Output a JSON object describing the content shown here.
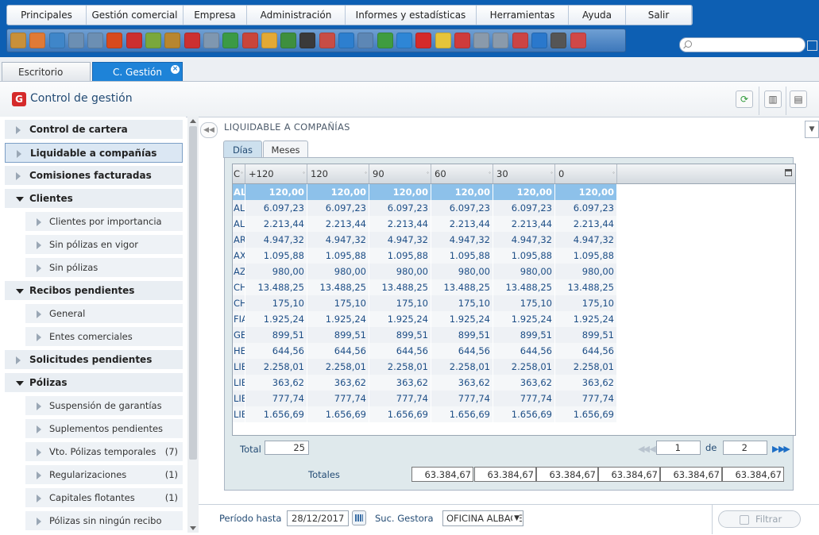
{
  "menu": [
    "Principales",
    "Gestión comercial",
    "Empresa",
    "Administración",
    "Informes y estadísticas",
    "Herramientas",
    "Ayuda",
    "Salir"
  ],
  "toolbar_icons": [
    {
      "name": "box-icon",
      "color": "#c8903a"
    },
    {
      "name": "user-orange-icon",
      "color": "#e07a36"
    },
    {
      "name": "user-blue-icon",
      "color": "#3f86c9"
    },
    {
      "name": "window-icon",
      "color": "#6c8fb3"
    },
    {
      "name": "window-split-icon",
      "color": "#6c8fb3"
    },
    {
      "name": "fire-icon",
      "color": "#d84a1d"
    },
    {
      "name": "target-icon",
      "color": "#cc2f2f"
    },
    {
      "name": "money-icon",
      "color": "#7aa83c"
    },
    {
      "name": "briefcase-icon",
      "color": "#b8862f"
    },
    {
      "name": "alarm-icon",
      "color": "#cc3030"
    },
    {
      "name": "mail-icon",
      "color": "#7f97b0"
    },
    {
      "name": "building-icon",
      "color": "#3b9a45"
    },
    {
      "name": "person-red-icon",
      "color": "#c9453a"
    },
    {
      "name": "lightbulb-person-icon",
      "color": "#e3a935"
    },
    {
      "name": "flag-icon",
      "color": "#3e8f3e"
    },
    {
      "name": "euro-dark-icon",
      "color": "#3a3a3a"
    },
    {
      "name": "person-euro-icon",
      "color": "#c84d45"
    },
    {
      "name": "euro-blue-icon",
      "color": "#2d7fcf"
    },
    {
      "name": "euro-arrow-icon",
      "color": "#5d87b5"
    },
    {
      "name": "euro-green-icon",
      "color": "#3f9c3f"
    },
    {
      "name": "sync-icon",
      "color": "#2e86d6"
    },
    {
      "name": "g-logo-icon",
      "color": "#d52a2a"
    },
    {
      "name": "bulb-icon",
      "color": "#e6c43a"
    },
    {
      "name": "card-icon",
      "color": "#cf3b3b"
    },
    {
      "name": "document-icon",
      "color": "#8a9aab"
    },
    {
      "name": "printer-doc-icon",
      "color": "#8a9aab"
    },
    {
      "name": "report-icon",
      "color": "#cc4444"
    },
    {
      "name": "pen-icon",
      "color": "#2a78cc"
    },
    {
      "name": "tools-icon",
      "color": "#555555"
    },
    {
      "name": "help-icon",
      "color": "#d04848"
    }
  ],
  "search": {
    "placeholder": ""
  },
  "tabs": [
    "Escritorio",
    "C. Gestión"
  ],
  "page_title": "Control de gestión",
  "app_logo": "G",
  "sidebar": [
    {
      "label": "Control de cartera",
      "level": 0,
      "state": "closed",
      "count": ""
    },
    {
      "label": "Liquidable a compañías",
      "level": 0,
      "state": "closed",
      "count": "",
      "selected": true
    },
    {
      "label": "Comisiones facturadas",
      "level": 0,
      "state": "closed",
      "count": ""
    },
    {
      "label": "Clientes",
      "level": 0,
      "state": "open",
      "count": ""
    },
    {
      "label": "Clientes por importancia",
      "level": 1,
      "state": "closed",
      "count": ""
    },
    {
      "label": "Sin pólizas en vigor",
      "level": 1,
      "state": "closed",
      "count": ""
    },
    {
      "label": "Sin pólizas",
      "level": 1,
      "state": "closed",
      "count": ""
    },
    {
      "label": "Recibos pendientes",
      "level": 0,
      "state": "open",
      "count": ""
    },
    {
      "label": "General",
      "level": 1,
      "state": "closed",
      "count": ""
    },
    {
      "label": "Entes comerciales",
      "level": 1,
      "state": "closed",
      "count": ""
    },
    {
      "label": "Solicitudes pendientes",
      "level": 0,
      "state": "closed",
      "count": ""
    },
    {
      "label": "Pólizas",
      "level": 0,
      "state": "open",
      "count": ""
    },
    {
      "label": "Suspensión de garantías",
      "level": 1,
      "state": "closed",
      "count": ""
    },
    {
      "label": "Suplementos pendientes",
      "level": 1,
      "state": "closed",
      "count": ""
    },
    {
      "label": "Vto. Pólizas temporales",
      "level": 1,
      "state": "closed",
      "count": "(7)"
    },
    {
      "label": "Regularizaciones",
      "level": 1,
      "state": "closed",
      "count": "(1)"
    },
    {
      "label": "Capitales flotantes",
      "level": 1,
      "state": "closed",
      "count": "(1)"
    },
    {
      "label": "Pólizas sin ningún recibo",
      "level": 1,
      "state": "closed",
      "count": ""
    }
  ],
  "section_title": "LIQUIDABLE A COMPAÑÍAS",
  "subtabs": [
    "Días",
    "Meses"
  ],
  "grid": {
    "columns": [
      "C",
      "+120",
      "120",
      "90",
      "60",
      "30",
      "0"
    ],
    "rows": [
      [
        "AL",
        "120,00",
        "120,00",
        "120,00",
        "120,00",
        "120,00",
        "120,00"
      ],
      [
        "AL",
        "6.097,23",
        "6.097,23",
        "6.097,23",
        "6.097,23",
        "6.097,23",
        "6.097,23"
      ],
      [
        "AL",
        "2.213,44",
        "2.213,44",
        "2.213,44",
        "2.213,44",
        "2.213,44",
        "2.213,44"
      ],
      [
        "AR",
        "4.947,32",
        "4.947,32",
        "4.947,32",
        "4.947,32",
        "4.947,32",
        "4.947,32"
      ],
      [
        "AX",
        "1.095,88",
        "1.095,88",
        "1.095,88",
        "1.095,88",
        "1.095,88",
        "1.095,88"
      ],
      [
        "AZ",
        "980,00",
        "980,00",
        "980,00",
        "980,00",
        "980,00",
        "980,00"
      ],
      [
        "CH",
        "13.488,25",
        "13.488,25",
        "13.488,25",
        "13.488,25",
        "13.488,25",
        "13.488,25"
      ],
      [
        "CH",
        "175,10",
        "175,10",
        "175,10",
        "175,10",
        "175,10",
        "175,10"
      ],
      [
        "FIA",
        "1.925,24",
        "1.925,24",
        "1.925,24",
        "1.925,24",
        "1.925,24",
        "1.925,24"
      ],
      [
        "GE",
        "899,51",
        "899,51",
        "899,51",
        "899,51",
        "899,51",
        "899,51"
      ],
      [
        "HE",
        "644,56",
        "644,56",
        "644,56",
        "644,56",
        "644,56",
        "644,56"
      ],
      [
        "LIE",
        "2.258,01",
        "2.258,01",
        "2.258,01",
        "2.258,01",
        "2.258,01",
        "2.258,01"
      ],
      [
        "LIE",
        "363,62",
        "363,62",
        "363,62",
        "363,62",
        "363,62",
        "363,62"
      ],
      [
        "LIE",
        "777,74",
        "777,74",
        "777,74",
        "777,74",
        "777,74",
        "777,74"
      ],
      [
        "LIE",
        "1.656,69",
        "1.656,69",
        "1.656,69",
        "1.656,69",
        "1.656,69",
        "1.656,69"
      ]
    ]
  },
  "pager": {
    "total_label": "Total",
    "total_value": "25",
    "page": "1",
    "of_label": "de",
    "pages": "2"
  },
  "totals": {
    "label": "Totales",
    "values": [
      "63.384,67",
      "63.384,67",
      "63.384,67",
      "63.384,67",
      "63.384,67",
      "63.384,67"
    ]
  },
  "footer": {
    "period_label": "Período hasta",
    "period_value": "28/12/2017",
    "office_label": "Suc. Gestora",
    "office_value": "OFICINA ALBACETE",
    "filter_label": "Filtrar"
  }
}
